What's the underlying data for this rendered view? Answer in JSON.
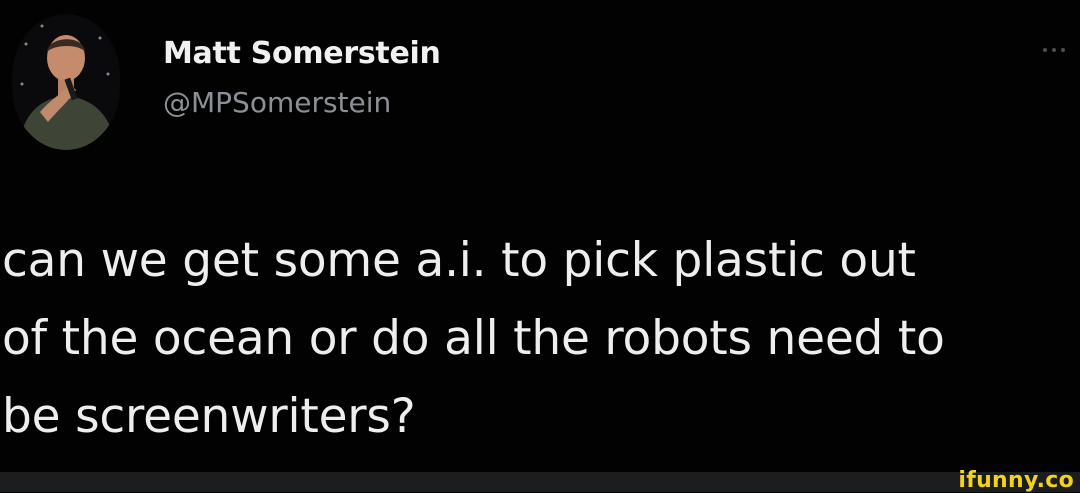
{
  "tweet": {
    "author": {
      "display_name": "Matt Somerstein",
      "handle": "@MPSomerstein"
    },
    "text_lines": [
      "can we get some a.i. to pick plastic out",
      "of the ocean or do all the robots need to",
      "be screenwriters?"
    ],
    "more_icon": "ellipsis-icon"
  },
  "footer": {
    "watermark": "ifunny.co"
  },
  "colors": {
    "background": "#000000",
    "text": "#eeeeee",
    "handle": "#8b9096",
    "watermark": "#f2d21a",
    "footer_bar": "#1c1d1f"
  }
}
